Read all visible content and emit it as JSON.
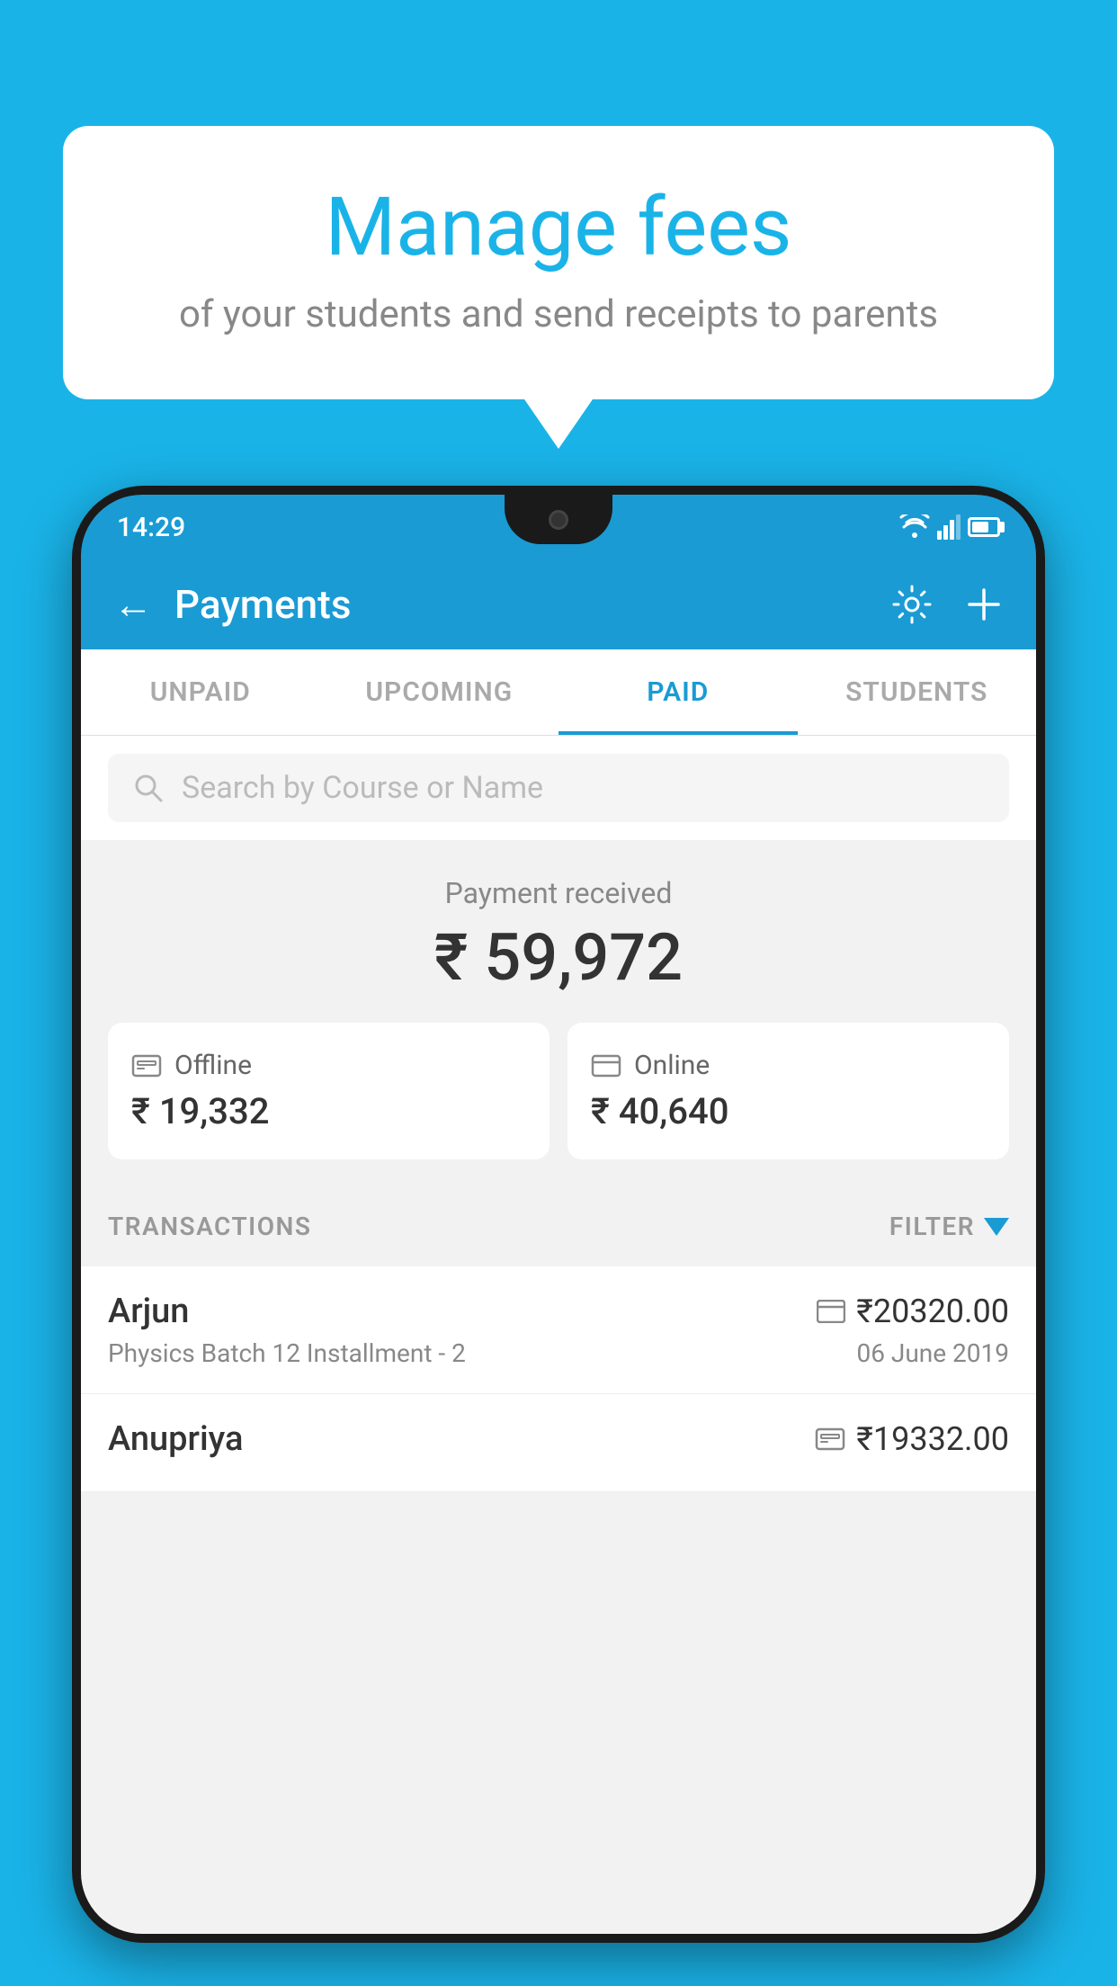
{
  "background_color": "#1ab3e8",
  "speech_bubble": {
    "title": "Manage fees",
    "subtitle": "of your students and send receipts to parents"
  },
  "status_bar": {
    "time": "14:29"
  },
  "app_header": {
    "title": "Payments",
    "back_label": "←",
    "gear_label": "⚙",
    "plus_label": "+"
  },
  "tabs": [
    {
      "label": "UNPAID",
      "active": false
    },
    {
      "label": "UPCOMING",
      "active": false
    },
    {
      "label": "PAID",
      "active": true
    },
    {
      "label": "STUDENTS",
      "active": false
    }
  ],
  "search": {
    "placeholder": "Search by Course or Name"
  },
  "payment_received": {
    "label": "Payment received",
    "amount": "₹ 59,972",
    "offline": {
      "type": "Offline",
      "amount": "₹ 19,332"
    },
    "online": {
      "type": "Online",
      "amount": "₹ 40,640"
    }
  },
  "transactions": {
    "section_label": "TRANSACTIONS",
    "filter_label": "FILTER",
    "items": [
      {
        "name": "Arjun",
        "course": "Physics Batch 12 Installment - 2",
        "amount": "₹20320.00",
        "date": "06 June 2019",
        "type": "online"
      },
      {
        "name": "Anupriya",
        "course": "",
        "amount": "₹19332.00",
        "date": "",
        "type": "offline"
      }
    ]
  }
}
